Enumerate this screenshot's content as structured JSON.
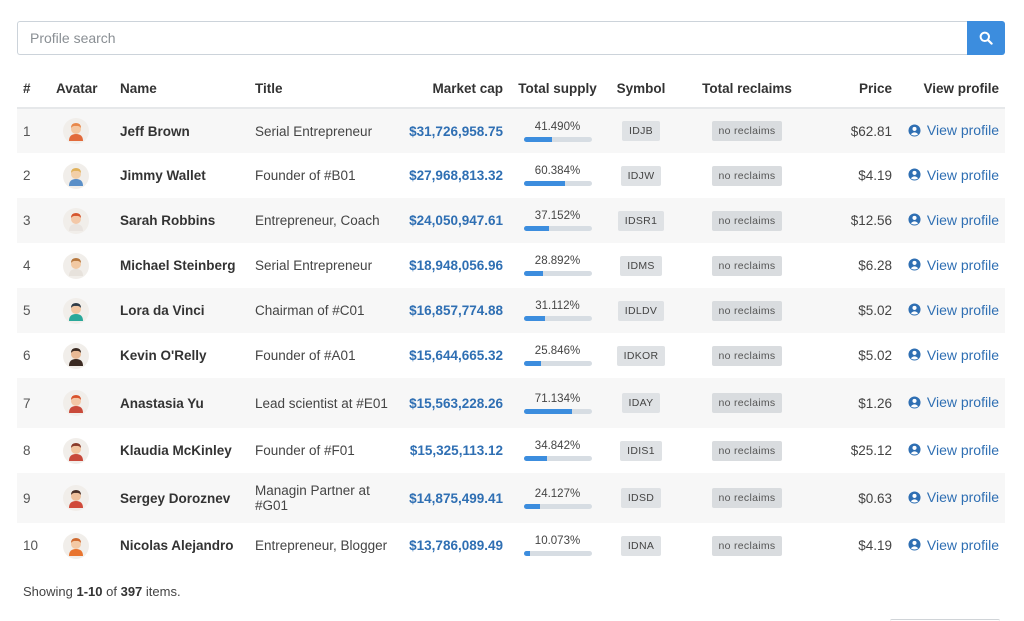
{
  "search": {
    "placeholder": "Profile search",
    "button_icon": "search-icon"
  },
  "table": {
    "headers": {
      "num": "#",
      "avatar": "Avatar",
      "name": "Name",
      "title": "Title",
      "market_cap": "Market cap",
      "total_supply": "Total supply",
      "symbol": "Symbol",
      "total_reclaims": "Total reclaims",
      "price": "Price",
      "view_profile": "View profile"
    },
    "rows": [
      {
        "num": "1",
        "avatar": "man-glasses-ginger-avatar",
        "name": "Jeff Brown",
        "title": "Serial Entrepreneur",
        "market_cap": "$31,726,958.75",
        "supply": "41.490%",
        "supply_fraction": 0.4149,
        "symbol": "IDJB",
        "reclaims": "no reclaims",
        "price": "$62.81",
        "link": "View profile"
      },
      {
        "num": "2",
        "avatar": "man-glasses-blond-avatar",
        "name": "Jimmy Wallet",
        "title": "Founder of #B01",
        "market_cap": "$27,968,813.32",
        "supply": "60.384%",
        "supply_fraction": 0.60384,
        "symbol": "IDJW",
        "reclaims": "no reclaims",
        "price": "$4.19",
        "link": "View profile"
      },
      {
        "num": "3",
        "avatar": "woman-redhead-avatar",
        "name": "Sarah Robbins",
        "title": "Entrepreneur, Coach",
        "market_cap": "$24,050,947.61",
        "supply": "37.152%",
        "supply_fraction": 0.37152,
        "symbol": "IDSR1",
        "reclaims": "no reclaims",
        "price": "$12.56",
        "link": "View profile"
      },
      {
        "num": "4",
        "avatar": "man-brown-hair-avatar",
        "name": "Michael Steinberg",
        "title": "Serial Entrepreneur",
        "market_cap": "$18,948,056.96",
        "supply": "28.892%",
        "supply_fraction": 0.28892,
        "symbol": "IDMS",
        "reclaims": "no reclaims",
        "price": "$6.28",
        "link": "View profile"
      },
      {
        "num": "5",
        "avatar": "man-teal-shirt-avatar",
        "name": "Lora da Vinci",
        "title": "Chairman of #C01",
        "market_cap": "$16,857,774.88",
        "supply": "31.112%",
        "supply_fraction": 0.31112,
        "symbol": "IDLDV",
        "reclaims": "no reclaims",
        "price": "$5.02",
        "link": "View profile"
      },
      {
        "num": "6",
        "avatar": "man-beard-avatar",
        "name": "Kevin O'Relly",
        "title": "Founder of #A01",
        "market_cap": "$15,644,665.32",
        "supply": "25.846%",
        "supply_fraction": 0.25846,
        "symbol": "IDKOR",
        "reclaims": "no reclaims",
        "price": "$5.02",
        "link": "View profile"
      },
      {
        "num": "7",
        "avatar": "woman-red-hair-avatar",
        "name": "Anastasia Yu",
        "title": "Lead scientist at #E01",
        "market_cap": "$15,563,228.26",
        "supply": "71.134%",
        "supply_fraction": 0.71134,
        "symbol": "IDAY",
        "reclaims": "no reclaims",
        "price": "$1.26",
        "link": "View profile"
      },
      {
        "num": "8",
        "avatar": "woman-bun-avatar",
        "name": "Klaudia McKinley",
        "title": "Founder of #F01",
        "market_cap": "$15,325,113.12",
        "supply": "34.842%",
        "supply_fraction": 0.34842,
        "symbol": "IDIS1",
        "reclaims": "no reclaims",
        "price": "$25.12",
        "link": "View profile"
      },
      {
        "num": "9",
        "avatar": "man-dark-hair-avatar",
        "name": "Sergey Doroznev",
        "title": "Managin Partner at #G01",
        "market_cap": "$14,875,499.41",
        "supply": "24.127%",
        "supply_fraction": 0.24127,
        "symbol": "IDSD",
        "reclaims": "no reclaims",
        "price": "$0.63",
        "link": "View profile"
      },
      {
        "num": "10",
        "avatar": "man-orange-shirt-avatar",
        "name": "Nicolas Alejandro",
        "title": "Entrepreneur, Blogger",
        "market_cap": "$13,786,089.49",
        "supply": "10.073%",
        "supply_fraction": 0.10073,
        "symbol": "IDNA",
        "reclaims": "no reclaims",
        "price": "$4.19",
        "link": "View profile"
      }
    ]
  },
  "summary": {
    "prefix": "Showing ",
    "range": "1-10",
    "middle": " of ",
    "total": "397",
    "suffix": " items."
  },
  "colors": {
    "accent": "#3c8dde",
    "link": "#2f6fb3",
    "bar_track": "#d7dde3",
    "badge": "#dfe2e5",
    "row_stripe": "#f7f7f7"
  }
}
